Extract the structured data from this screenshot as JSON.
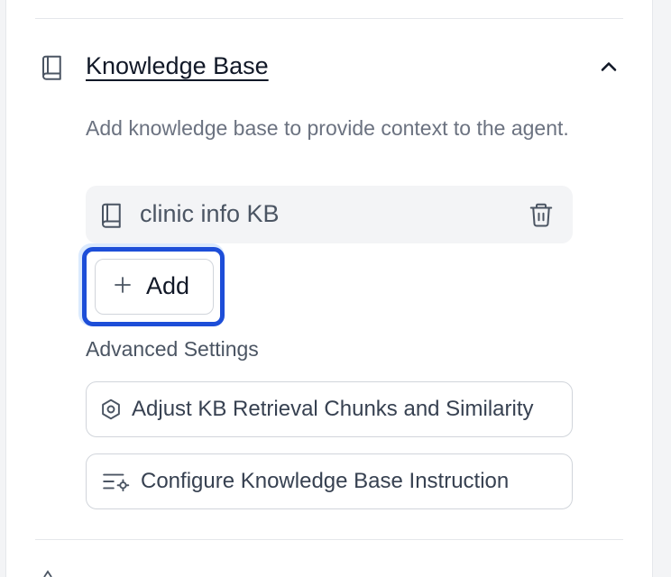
{
  "section": {
    "icon": "book-icon",
    "title": "Knowledge Base",
    "toggle_icon": "chevron-up-icon",
    "description": "Add knowledge base to provide context to the agent."
  },
  "kb_items": [
    {
      "name": "clinic info KB",
      "icon": "book-icon",
      "action_icon": "trash-icon"
    }
  ],
  "add_button": {
    "label": "Add",
    "icon": "plus-icon"
  },
  "advanced": {
    "label": "Advanced Settings",
    "buttons": [
      {
        "label": "Adjust KB Retrieval Chunks and Similarity",
        "icon": "settings-hex-icon"
      },
      {
        "label": "Configure Knowledge Base Instruction",
        "icon": "list-settings-icon"
      }
    ]
  },
  "colors": {
    "focus_ring": "#1d4ed8",
    "focus_halo": "#dbeafe",
    "muted_text": "#6b7280",
    "item_bg": "#f3f4f6"
  }
}
